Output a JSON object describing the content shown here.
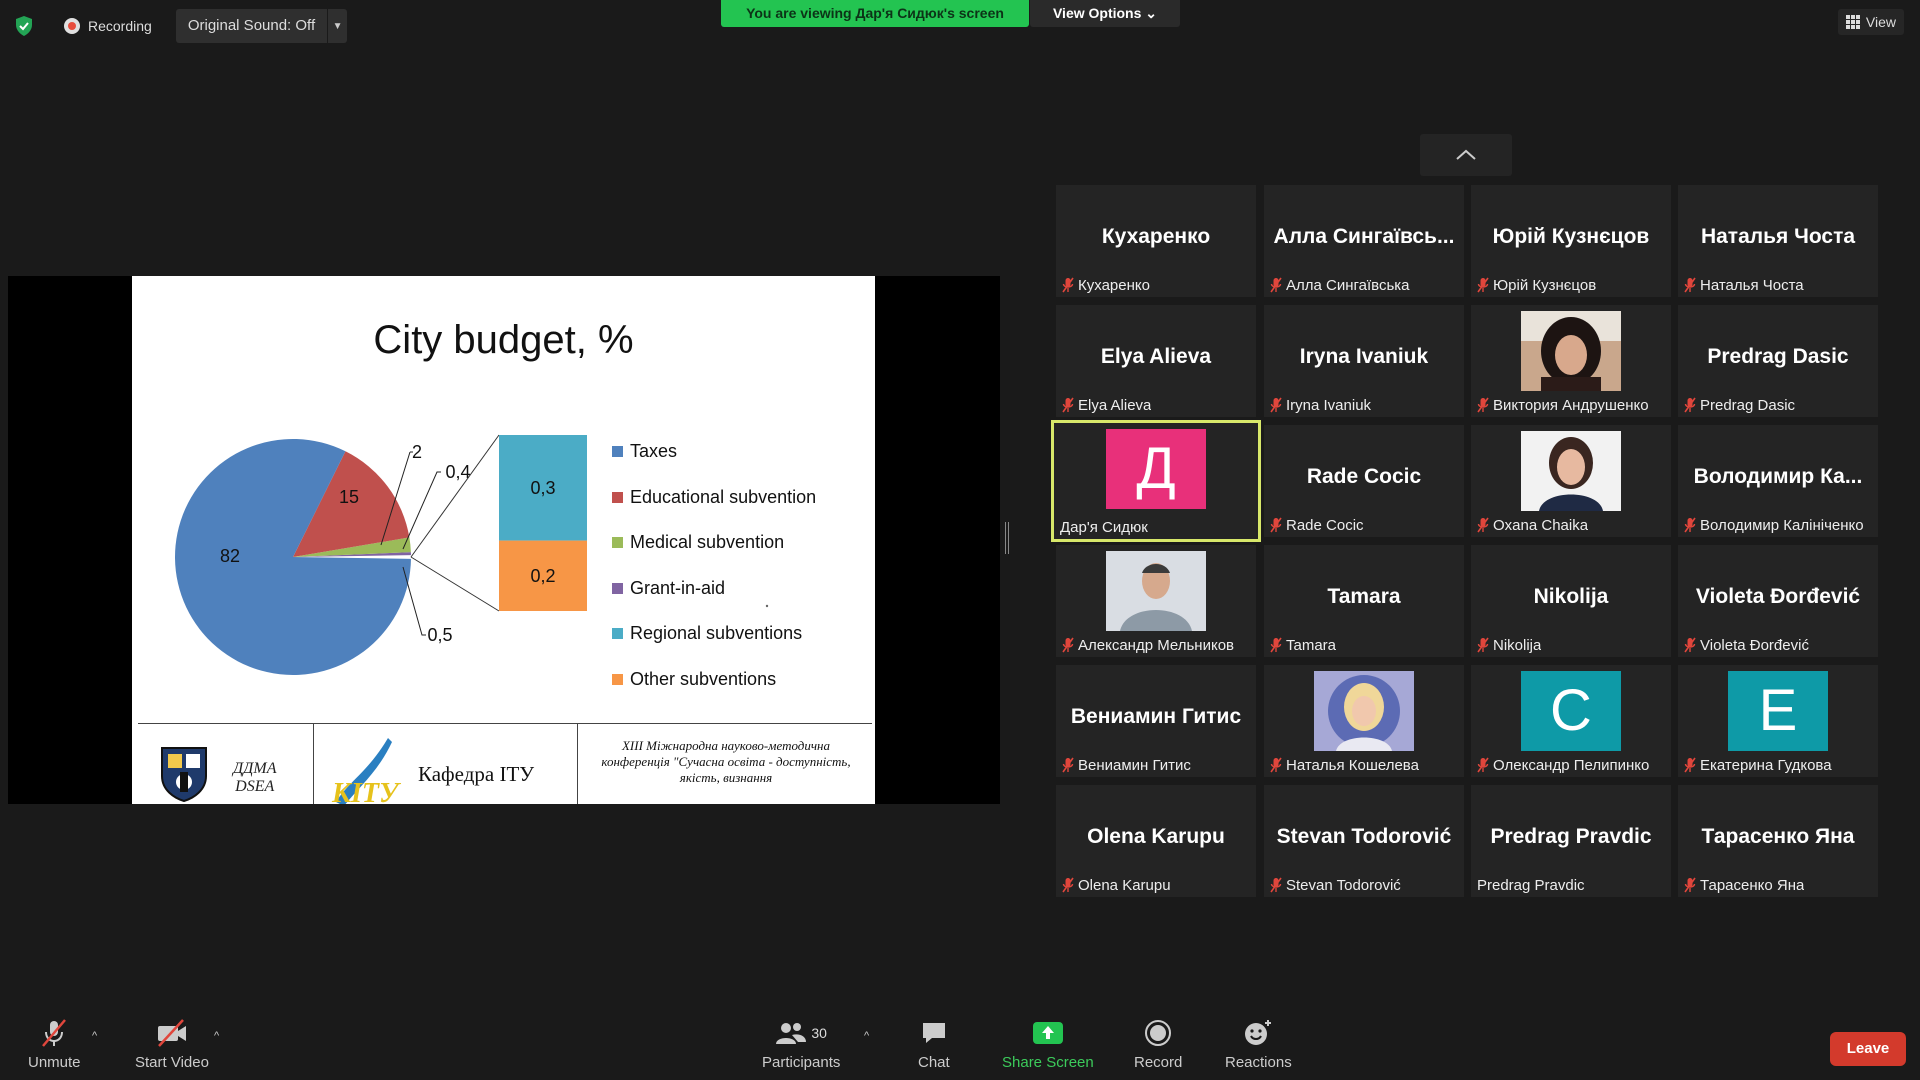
{
  "topbar": {
    "recording_label": "Recording",
    "original_sound": "Original Sound: Off",
    "viewing_banner": "You are viewing Дар'я Сидюк's screen",
    "view_options": "View Options",
    "view_label": "View"
  },
  "slide": {
    "title": "City budget, %",
    "footer_left": "ДДМА\nDSEA",
    "footer_mid": "Кафедра ІТУ",
    "footer_right": "XIII Міжнародна науково-методична конференція \"Сучасна освіта - доступність, якість, визнання"
  },
  "chart_data": {
    "type": "pie",
    "title": "City budget, %",
    "slices": [
      {
        "label": "Taxes",
        "value": 82,
        "color": "#4f81bd"
      },
      {
        "label": "Educational subvention",
        "value": 15,
        "color": "#c0504d"
      },
      {
        "label": "Medical subvention",
        "value": 2,
        "color": "#9bbb59"
      },
      {
        "label": "Grant-in-aid",
        "value": 0.4,
        "color": "#8064a2"
      },
      {
        "label": "Regional subventions",
        "value": 0.3,
        "color": "#4bacc6"
      },
      {
        "label": "Other subventions",
        "value": 0.2,
        "color": "#f79646"
      }
    ],
    "data_labels": [
      "82",
      "15",
      "2",
      "0,4",
      "0,3",
      "0,2",
      "0,5"
    ],
    "legend": [
      "Taxes",
      "Educational subvention",
      "Medical subvention",
      "Grant-in-aid",
      "Regional subventions",
      "Other subventions"
    ],
    "legend_position": "right",
    "breakout_bar": {
      "total_label": "0,5",
      "segments": [
        {
          "label": "0,3",
          "value": 0.3,
          "color": "#4bacc6"
        },
        {
          "label": "0,2",
          "value": 0.2,
          "color": "#f79646"
        }
      ]
    }
  },
  "gallery": {
    "tiles": [
      {
        "big": "Кухаренко",
        "name": "Кухаренко",
        "muted": true
      },
      {
        "big": "Алла Сингаївсь...",
        "name": "Алла Сингаївська",
        "muted": true
      },
      {
        "big": "Юрій Кузнєцов",
        "name": "Юрій Кузнєцов",
        "muted": true
      },
      {
        "big": "Наталья Чоста",
        "name": "Наталья Чоста",
        "muted": true
      },
      {
        "big": "Elya Alieva",
        "name": "Elya Alieva",
        "muted": true
      },
      {
        "big": "Iryna Ivaniuk",
        "name": "Iryna Ivaniuk",
        "muted": true
      },
      {
        "big": "",
        "name": "Виктория Андрушенко",
        "muted": true,
        "photo": "photo-woman-dark-hair"
      },
      {
        "big": "Predrag Dasic",
        "name": "Predrag Dasic",
        "muted": true
      },
      {
        "big": "",
        "name": "Дар'я Сидюк",
        "muted": false,
        "avatar": "Д",
        "avatar_color": "#e8307a",
        "active": true
      },
      {
        "big": "Rade Cocic",
        "name": "Rade Cocic",
        "muted": true
      },
      {
        "big": "",
        "name": "Oxana Chaika",
        "muted": true,
        "photo": "photo-woman-portrait"
      },
      {
        "big": "Володимир Ка...",
        "name": "Володимир Калініченко",
        "muted": true
      },
      {
        "big": "",
        "name": "Александр Мельников",
        "muted": true,
        "photo": "photo-man-portrait"
      },
      {
        "big": "Tamara",
        "name": "Tamara",
        "muted": true
      },
      {
        "big": "Nikolija",
        "name": "Nikolija",
        "muted": true
      },
      {
        "big": "Violeta Đorđević",
        "name": "Violeta Đorđević",
        "muted": true
      },
      {
        "big": "Вениамин Гитис",
        "name": "Вениамин Гитис",
        "muted": true
      },
      {
        "big": "",
        "name": "Наталья Кошелева",
        "muted": true,
        "photo": "photo-woman-blonde"
      },
      {
        "big": "",
        "name": "Олександр Пелипинко",
        "muted": true,
        "avatar": "C",
        "avatar_color": "#0e9aa7"
      },
      {
        "big": "",
        "name": "Екатерина Гудкова",
        "muted": true,
        "avatar": "E",
        "avatar_color": "#0e9aa7"
      },
      {
        "big": "Olena Karupu",
        "name": "Olena Karupu",
        "muted": true
      },
      {
        "big": "Stevan Todorović",
        "name": "Stevan Todorović",
        "muted": true
      },
      {
        "big": "Predrag Pravdic",
        "name": "Predrag Pravdic",
        "muted": false
      },
      {
        "big": "Тарасенко Яна",
        "name": "Тарасенко Яна",
        "muted": true
      }
    ]
  },
  "toolbar": {
    "unmute": "Unmute",
    "start_video": "Start Video",
    "participants": "Participants",
    "participants_count": "30",
    "chat": "Chat",
    "share_screen": "Share Screen",
    "record": "Record",
    "reactions": "Reactions",
    "leave": "Leave"
  },
  "colors": {
    "share_green": "#23c451",
    "active_border": "#d8e86a",
    "leave_red": "#d33a2c",
    "mute_red": "#e0463c"
  }
}
